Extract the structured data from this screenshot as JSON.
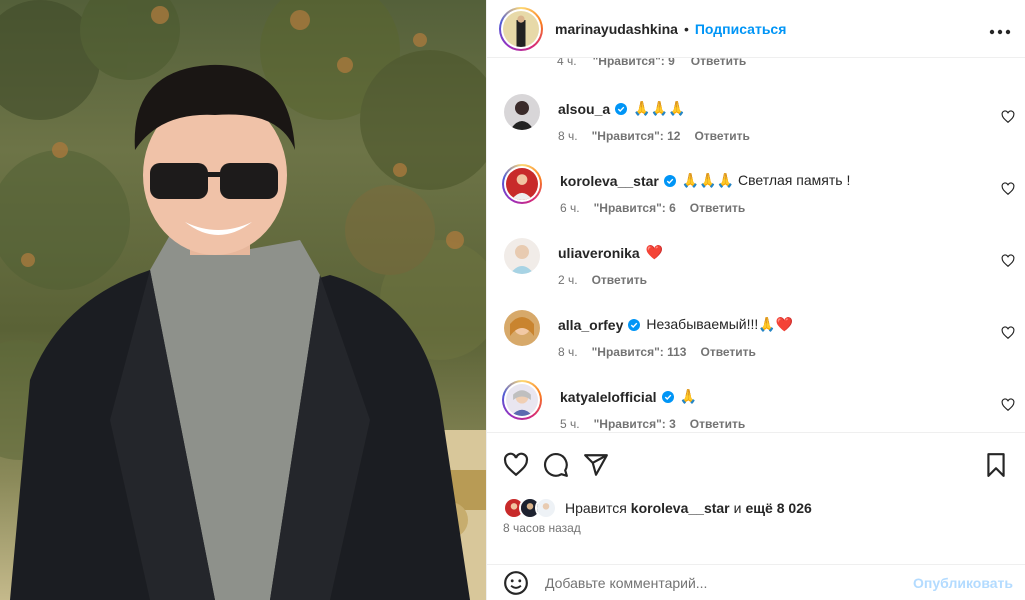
{
  "header": {
    "username": "marinayudashkina",
    "separator": "•",
    "follow_label": "Подписаться",
    "more_icon": "more-horizontal-icon"
  },
  "partial_comment": {
    "time": "4 ч.",
    "likes": "\"Нравится\": 9",
    "reply": "Ответить"
  },
  "comments": [
    {
      "username": "alsou_a",
      "verified": true,
      "text": "🙏🙏🙏",
      "time": "8 ч.",
      "likes": "\"Нравится\": 12",
      "reply": "Ответить"
    },
    {
      "username": "koroleva__star",
      "verified": true,
      "text": "🙏🙏🙏 Светлая память !",
      "time": "6 ч.",
      "likes": "\"Нравится\": 6",
      "reply": "Ответить"
    },
    {
      "username": "uliaveronika",
      "verified": false,
      "text": "❤️",
      "time": "2 ч.",
      "likes": "",
      "reply": "Ответить"
    },
    {
      "username": "alla_orfey",
      "verified": true,
      "text": "Незабываемый!!!🙏❤️",
      "time": "8 ч.",
      "likes": "\"Нравится\": 113",
      "reply": "Ответить"
    },
    {
      "username": "katyalelofficial",
      "verified": true,
      "text": "🙏",
      "time": "5 ч.",
      "likes": "\"Нравится\": 3",
      "reply": "Ответить"
    }
  ],
  "likes": {
    "prefix": "Нравится",
    "user": "koroleva__star",
    "middle": "и",
    "count": "ещё 8 026"
  },
  "timestamp": "8 часов назад",
  "add_comment": {
    "placeholder": "Добавьте комментарий...",
    "publish_label": "Опубликовать"
  },
  "colors": {
    "accent": "#0095f6",
    "verified": "#0095f6",
    "publish_disabled": "#b3dbff",
    "muted": "#737373"
  }
}
